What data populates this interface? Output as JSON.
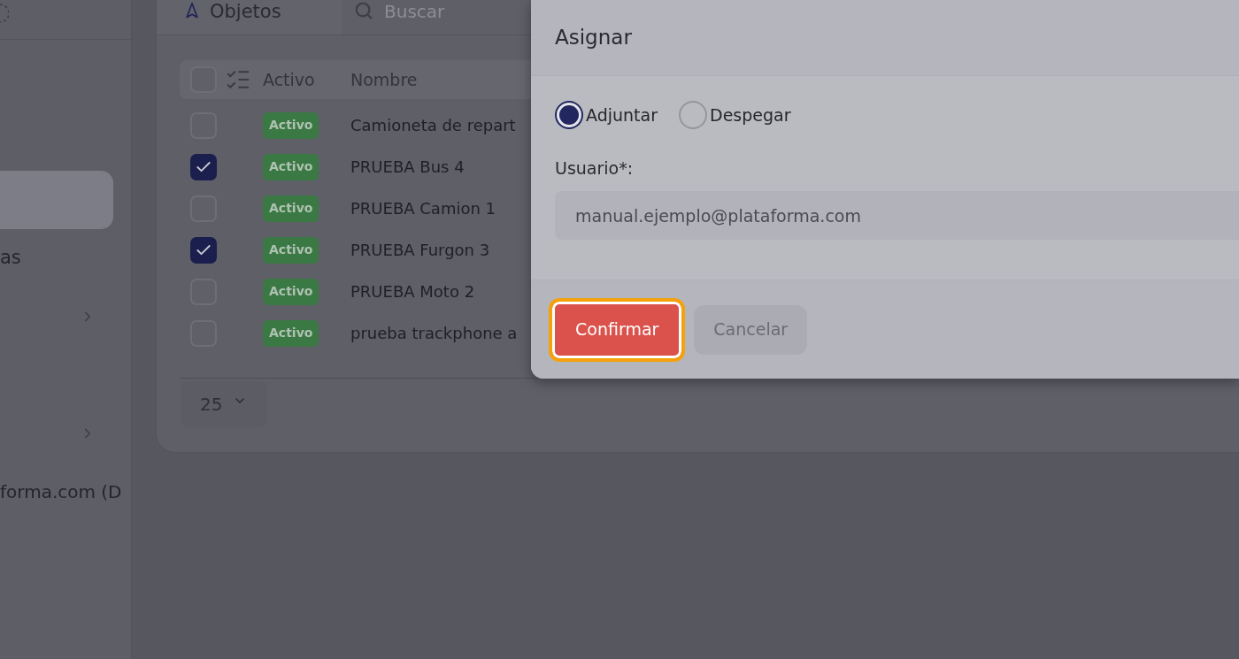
{
  "sidebar": {
    "items": [
      {
        "kind": "blank",
        "selected": true
      },
      {
        "kind": "text",
        "label": "as",
        "selected": false
      },
      {
        "kind": "submenu",
        "selected": false
      },
      {
        "kind": "submenu",
        "selected": false
      }
    ],
    "account": "forma.com (D"
  },
  "toolbar": {
    "title": "Objetos",
    "search": {
      "placeholder": "Buscar"
    }
  },
  "table": {
    "select_all": {
      "checked": false
    },
    "columns": [
      "Activo",
      "Nombre"
    ],
    "rows": [
      {
        "checked": false,
        "status": "Activo",
        "name": "Camioneta de repart"
      },
      {
        "checked": true,
        "status": "Activo",
        "name": "PRUEBA Bus 4"
      },
      {
        "checked": false,
        "status": "Activo",
        "name": "PRUEBA Camion 1"
      },
      {
        "checked": true,
        "status": "Activo",
        "name": "PRUEBA Furgon 3"
      },
      {
        "checked": false,
        "status": "Activo",
        "name": "PRUEBA Moto 2"
      },
      {
        "checked": false,
        "status": "Activo",
        "name": "prueba trackphone a"
      }
    ]
  },
  "pagination": {
    "page_size": "25"
  },
  "dialog": {
    "title": "Asignar",
    "options": [
      {
        "label": "Adjuntar",
        "selected": true
      },
      {
        "label": "Despegar",
        "selected": false
      }
    ],
    "field": {
      "label": "Usuario*:",
      "value": "manual.ejemplo@plataforma.com"
    },
    "buttons": [
      {
        "label": "Confirmar",
        "kind": "primary",
        "focused": true
      },
      {
        "label": "Cancelar",
        "kind": "secondary",
        "focused": false
      }
    ]
  }
}
